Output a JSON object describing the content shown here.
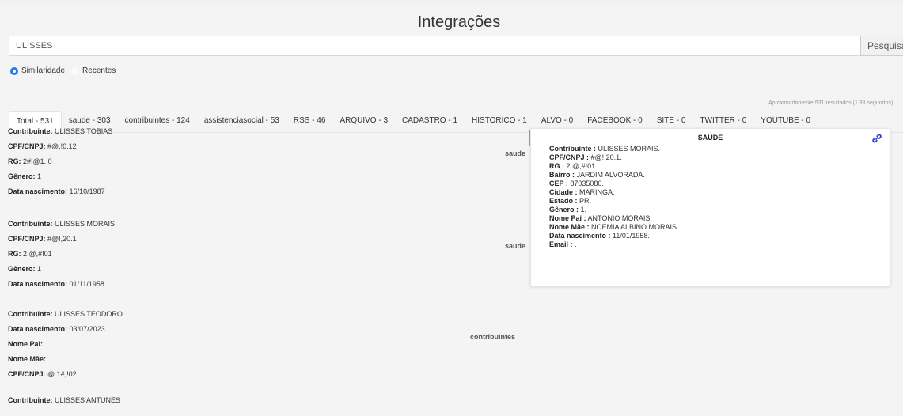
{
  "header": {
    "title": "Integrações"
  },
  "search": {
    "value": "ULISSES",
    "button_label": "Pesquisar"
  },
  "sort": {
    "options": [
      {
        "label": "Similaridade",
        "checked": true
      },
      {
        "label": "Recentes",
        "checked": false
      }
    ]
  },
  "results_info": "Aproximadamente 531 resultados (1.33 segundos)",
  "tabs": [
    {
      "label": "Total - 531",
      "active": true
    },
    {
      "label": "saude - 303"
    },
    {
      "label": "contribuintes - 124"
    },
    {
      "label": "assistenciasocial - 53"
    },
    {
      "label": "RSS - 46"
    },
    {
      "label": "ARQUIVO - 3"
    },
    {
      "label": "CADASTRO - 1"
    },
    {
      "label": "HISTORICO - 1"
    },
    {
      "label": "ALVO - 0"
    },
    {
      "label": "FACEBOOK - 0"
    },
    {
      "label": "SITE - 0"
    },
    {
      "label": "TWITTER - 0"
    },
    {
      "label": "YOUTUBE - 0"
    }
  ],
  "results": [
    {
      "source": "saude",
      "fields": [
        {
          "label": "Contribuinte:",
          "value": "ULISSES TOBIAS"
        },
        {
          "label": "CPF/CNPJ:",
          "value": "#@,!0.12"
        },
        {
          "label": "RG:",
          "value": "2#!@1.,0"
        },
        {
          "label": "Gênero:",
          "value": "1"
        },
        {
          "label": "Data nascimento:",
          "value": "16/10/1987"
        }
      ]
    },
    {
      "source": "saude",
      "fields": [
        {
          "label": "Contribuinte:",
          "value": "ULISSES MORAIS"
        },
        {
          "label": "CPF/CNPJ:",
          "value": "#@!,20.1"
        },
        {
          "label": "RG:",
          "value": "2.@,#!01"
        },
        {
          "label": "Gênero:",
          "value": "1"
        },
        {
          "label": "Data nascimento:",
          "value": "01/11/1958"
        }
      ]
    },
    {
      "source": "contribuintes",
      "fields": [
        {
          "label": "Contribuinte:",
          "value": "ULISSES TEODORO"
        },
        {
          "label": "Data nascimento:",
          "value": "03/07/2023"
        },
        {
          "label": "Nome Pai:",
          "value": ""
        },
        {
          "label": "Nome Mãe:",
          "value": ""
        },
        {
          "label": "CPF/CNPJ:",
          "value": "@.1#,!02"
        }
      ]
    },
    {
      "source": "",
      "fields": [
        {
          "label": "Contribuinte:",
          "value": "ULISSES ANTUNES"
        }
      ]
    }
  ],
  "detail": {
    "title": "SAUDE",
    "link_icon": "link-icon",
    "fields": [
      {
        "label": "Contribuinte :",
        "value": "ULISSES MORAIS."
      },
      {
        "label": "CPF/CNPJ :",
        "value": "#@!,20.1."
      },
      {
        "label": "RG :",
        "value": "2.@,#!01."
      },
      {
        "label": "Bairro :",
        "value": "JARDIM ALVORADA."
      },
      {
        "label": "CEP :",
        "value": "87035080."
      },
      {
        "label": "Cidade :",
        "value": "MARINGA."
      },
      {
        "label": "Estado :",
        "value": "PR."
      },
      {
        "label": "Gênero :",
        "value": "1."
      },
      {
        "label": "Nome Pai :",
        "value": "ANTONIO MORAIS."
      },
      {
        "label": "Nome Mãe :",
        "value": "NOEMIA ALBINO MORAIS."
      },
      {
        "label": "Data nascimento :",
        "value": "11/01/1958."
      },
      {
        "label": "Email :",
        "value": "."
      }
    ]
  },
  "colors": {
    "accent": "#1a7ef2",
    "link": "#2a3fd8"
  }
}
